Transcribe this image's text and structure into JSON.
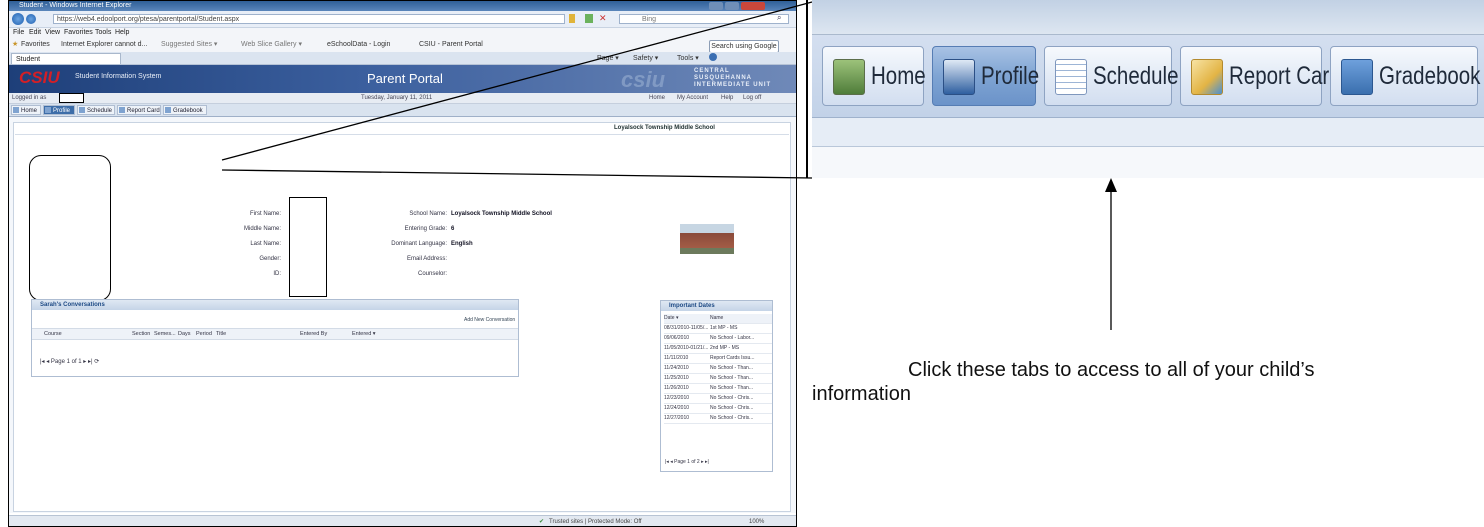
{
  "browser": {
    "title": "Student - Windows Internet Explorer",
    "address": "https://web4.edoolport.org/ptesa/parentportal/Student.aspx",
    "search_placeholder": "Bing",
    "menu": [
      "File",
      "Edit",
      "View",
      "Favorites",
      "Tools",
      "Help"
    ],
    "favorites_label": "Favorites",
    "favorites": [
      "Internet Explorer cannot d...",
      "Suggested Sites ▾",
      "Web Slice Gallery ▾",
      "eSchoolData - Login",
      "CSIU - Parent Portal"
    ],
    "search_google": "Search using Google",
    "tab": "Student",
    "command_bar": [
      "Page ▾",
      "Safety ▾",
      "Tools ▾"
    ],
    "statusbar": "Trusted sites | Protected Mode: Off",
    "zoom": "100%"
  },
  "portal": {
    "system_title": "Student Information System",
    "portal_title": "Parent Portal",
    "org_lines": [
      "CENTRAL",
      "SUSQUEHANNA",
      "INTERMEDIATE UNIT"
    ],
    "logged_in": "Logged in as",
    "date": "Tuesday, January 11, 2011",
    "top_links": [
      "Home",
      "My Account",
      "Help",
      "Log off"
    ],
    "tabs": [
      "Home",
      "Profile",
      "Schedule",
      "Report Card",
      "Gradebook"
    ],
    "active_tab": "Profile",
    "school_header": "Loyalsock Township Middle School",
    "fields_left": [
      "First Name:",
      "Middle Name:",
      "Last Name:",
      "Gender:",
      "ID:"
    ],
    "fields_right_labels": [
      "School Name:",
      "Entering Grade:",
      "Dominant Language:",
      "Email Address:",
      "Counselor:"
    ],
    "fields_right_values": [
      "Loyalsock Township Middle School",
      "6",
      "English",
      "",
      ""
    ],
    "conversations_title": "Sarah's Conversations",
    "add_conversation": "Add New Conversation",
    "conv_columns": [
      "Course",
      "Section",
      "Semes...",
      "Days",
      "Period",
      "Title",
      "Entered By",
      "Entered ▾"
    ],
    "pager_text": "Page 1 of 1",
    "dates_title": "Important Dates",
    "dates_columns": [
      "Date ▾",
      "Name"
    ],
    "dates_rows": [
      [
        "08/31/2010-11/05/...",
        "1st MP - MS"
      ],
      [
        "09/06/2010",
        "No School - Labor..."
      ],
      [
        "11/05/2010-01/21/...",
        "2nd MP - MS"
      ],
      [
        "11/11/2010",
        "Report Cards Issu..."
      ],
      [
        "11/24/2010",
        "No School - Than..."
      ],
      [
        "11/25/2010",
        "No School - Than..."
      ],
      [
        "11/26/2010",
        "No School - Than..."
      ],
      [
        "12/23/2010",
        "No School - Chris..."
      ],
      [
        "12/24/2010",
        "No School - Chris..."
      ],
      [
        "12/27/2010",
        "No School - Chris..."
      ]
    ],
    "dates_pager": "Page 1 of 2"
  },
  "zoom_panel": {
    "tabs": [
      {
        "label": "Home",
        "icon": "home-icon",
        "color": "#4f7d3a"
      },
      {
        "label": "Profile",
        "icon": "profile-card-icon",
        "color": "#2f5fa0"
      },
      {
        "label": "Schedule",
        "icon": "calendar-grid-icon",
        "color": "#9db5d6"
      },
      {
        "label": "Report Card",
        "icon": "report-card-icon",
        "color": "#e3b445"
      },
      {
        "label": "Gradebook",
        "icon": "gradebook-icon",
        "color": "#3a6fae"
      }
    ],
    "active": "Profile"
  },
  "annotation": {
    "text_line1": "Click these tabs to access to all of your child’s",
    "text_line2": "information"
  },
  "colors": {
    "banner": "#1e3f79",
    "active_tab": "#3d6da8",
    "logo": "#d41f26"
  }
}
